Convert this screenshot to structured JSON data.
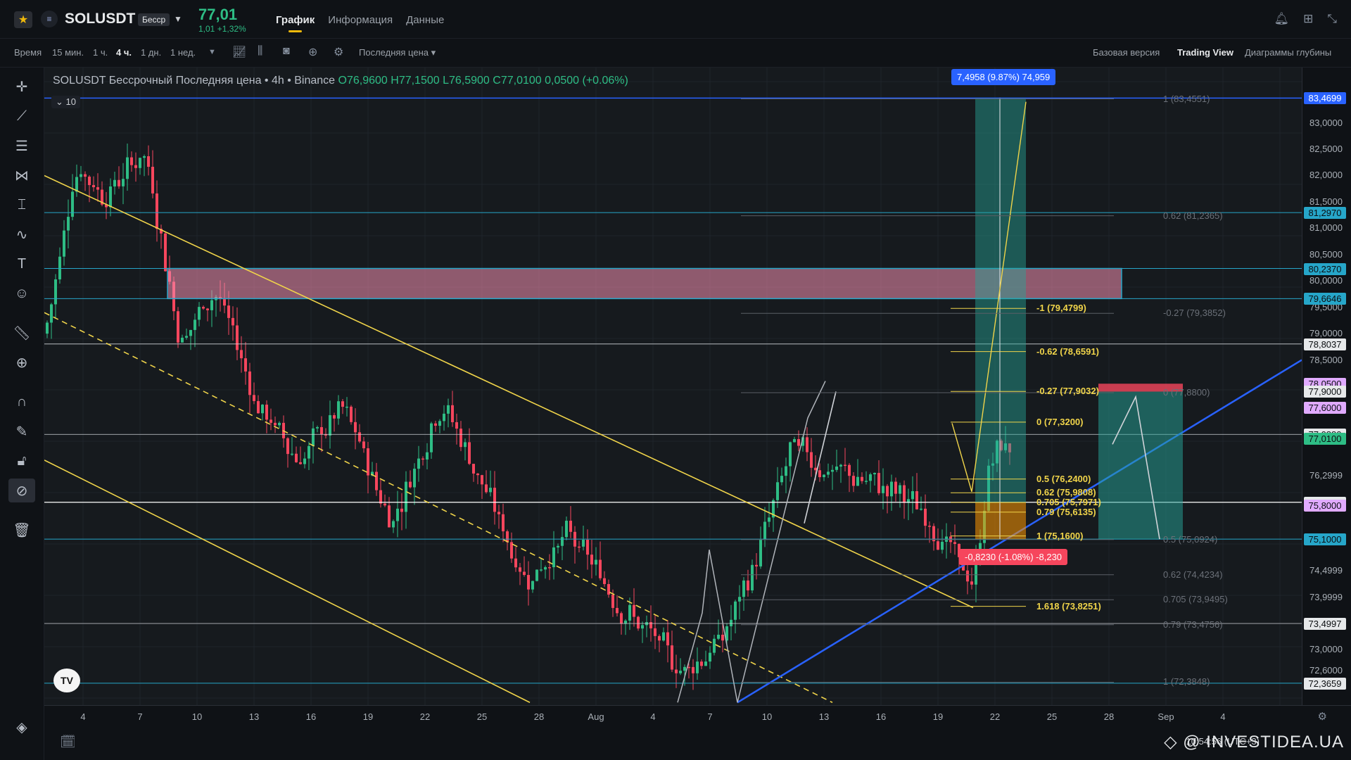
{
  "header": {
    "symbol": "SOLUSDT",
    "contract_tag": "Бесср",
    "last_price": "77,01",
    "change": "1,01 +1,32%",
    "tabs": [
      {
        "label": "График",
        "active": true
      },
      {
        "label": "Информация",
        "active": false
      },
      {
        "label": "Данные",
        "active": false
      }
    ],
    "icons": [
      "bell-icon",
      "grid-icon",
      "collapse-icon"
    ]
  },
  "toolbar": {
    "time_label": "Время",
    "intervals": [
      "15 мин.",
      "1 ч.",
      "4 ч.",
      "1 дн.",
      "1 нед."
    ],
    "active_interval": "4 ч.",
    "price_source": "Последняя цена ▾",
    "views": [
      "Базовая версия",
      "Trading View",
      "Диаграммы глубины"
    ],
    "active_view": "Trading View"
  },
  "chart": {
    "legend_title": "SOLUSDT Бессрочный Последняя цена • 4h • Binance",
    "legend_values": "O76,9600 H77,1500 L76,5900 C77,0100 0,0500 (+0.06%)",
    "indicator_count": "10",
    "logo_text": "TV",
    "measure_top": "7,4958 (9.87%) 74,959",
    "measure_bottom": "-0,8230 (-1.08%) -8,230",
    "fib_yellow": [
      {
        "label": "-1 (79,4799)",
        "price": 79.4799
      },
      {
        "label": "-0.62 (78,6591)",
        "price": 78.6591
      },
      {
        "label": "-0.27 (77,9032)",
        "price": 77.9032
      },
      {
        "label": "0 (77,3200)",
        "price": 77.32
      },
      {
        "label": "0.5 (76,2400)",
        "price": 76.24
      },
      {
        "label": "0.62 (75,9808)",
        "price": 75.9808
      },
      {
        "label": "0.705 (75,7971)",
        "price": 75.7971
      },
      {
        "label": "0.79 (75,6135)",
        "price": 75.6135
      },
      {
        "label": "1 (75,1600)",
        "price": 75.16
      },
      {
        "label": "1.618 (73,8251)",
        "price": 73.8251
      }
    ],
    "fib_grey": [
      {
        "label": "1 (83,4551)",
        "price": 83.4551
      },
      {
        "label": "0.62 (81,2365)",
        "price": 81.2365
      },
      {
        "label": "-0.27 (79,3852)",
        "price": 79.3852
      },
      {
        "label": "0 (77,8800)",
        "price": 77.88
      },
      {
        "label": "0.5 (75,0924)",
        "price": 75.0924
      },
      {
        "label": "0.62 (74,4234)",
        "price": 74.4234
      },
      {
        "label": "0.705 (73,9495)",
        "price": 73.9495
      },
      {
        "label": "0.79 (73,4756)",
        "price": 73.4756
      },
      {
        "label": "1 (72,3848)",
        "price": 72.3848
      }
    ]
  },
  "price_axis": {
    "ticks": [
      "83,0000",
      "82,5000",
      "82,0000",
      "81,5000",
      "81,0000",
      "80,5000",
      "80,0000",
      "79,5000",
      "79,0000",
      "78,5000",
      "76,2999",
      "74,4999",
      "73,9999",
      "73,0000",
      "72,6000"
    ],
    "labels": [
      {
        "text": "83,4699",
        "price": 83.4699,
        "color": "#2962ff",
        "fg": "#ffffff"
      },
      {
        "text": "81,2970",
        "price": 81.297,
        "color": "#26a6c9",
        "fg": "#0b0e11"
      },
      {
        "text": "80,2370",
        "price": 80.237,
        "color": "#26a6c9",
        "fg": "#0b0e11"
      },
      {
        "text": "79,6646",
        "price": 79.6646,
        "color": "#26a6c9",
        "fg": "#0b0e11"
      },
      {
        "text": "78,8037",
        "price": 78.8037,
        "color": "#e6e8ea",
        "fg": "#0b0e11"
      },
      {
        "text": "78,0500",
        "price": 78.05,
        "color": "#e0aaff",
        "fg": "#0b0e11"
      },
      {
        "text": "77,9000",
        "price": 77.9,
        "color": "#e6e8ea",
        "fg": "#0b0e11"
      },
      {
        "text": "77,6000",
        "price": 77.6,
        "color": "#e0aaff",
        "fg": "#0b0e11"
      },
      {
        "text": "77,0880",
        "price": 77.088,
        "color": "#e6e8ea",
        "fg": "#0b0e11"
      },
      {
        "text": "77,0100",
        "price": 77.01,
        "color": "#2ebd85",
        "fg": "#0b0e11"
      },
      {
        "text": "75,8000",
        "price": 75.8,
        "color": "#e6e8ea",
        "fg": "#0b0e11"
      },
      {
        "text": "75,8000",
        "price": 75.74,
        "color": "#e0aaff",
        "fg": "#0b0e11"
      },
      {
        "text": "75,1000",
        "price": 75.1,
        "color": "#26a6c9",
        "fg": "#0b0e11"
      },
      {
        "text": "73,4997",
        "price": 73.4997,
        "color": "#e6e8ea",
        "fg": "#0b0e11"
      },
      {
        "text": "72,3659",
        "price": 72.3659,
        "color": "#e6e8ea",
        "fg": "#0b0e11"
      }
    ]
  },
  "time_axis": {
    "ticks": [
      "4",
      "7",
      "10",
      "13",
      "16",
      "19",
      "22",
      "25",
      "28",
      "Aug",
      "4",
      "7",
      "10",
      "13",
      "16",
      "19",
      "22",
      "25",
      "28",
      "Sep",
      "4"
    ]
  },
  "footer": {
    "clock": "10:54:56 (UTC+3)",
    "watermark": "INVESTIDEA.UA"
  },
  "colors": {
    "up": "#2ebd85",
    "down": "#f6465d",
    "fib_yellow": "#f0d44a",
    "accent": "#f0b90b"
  }
}
